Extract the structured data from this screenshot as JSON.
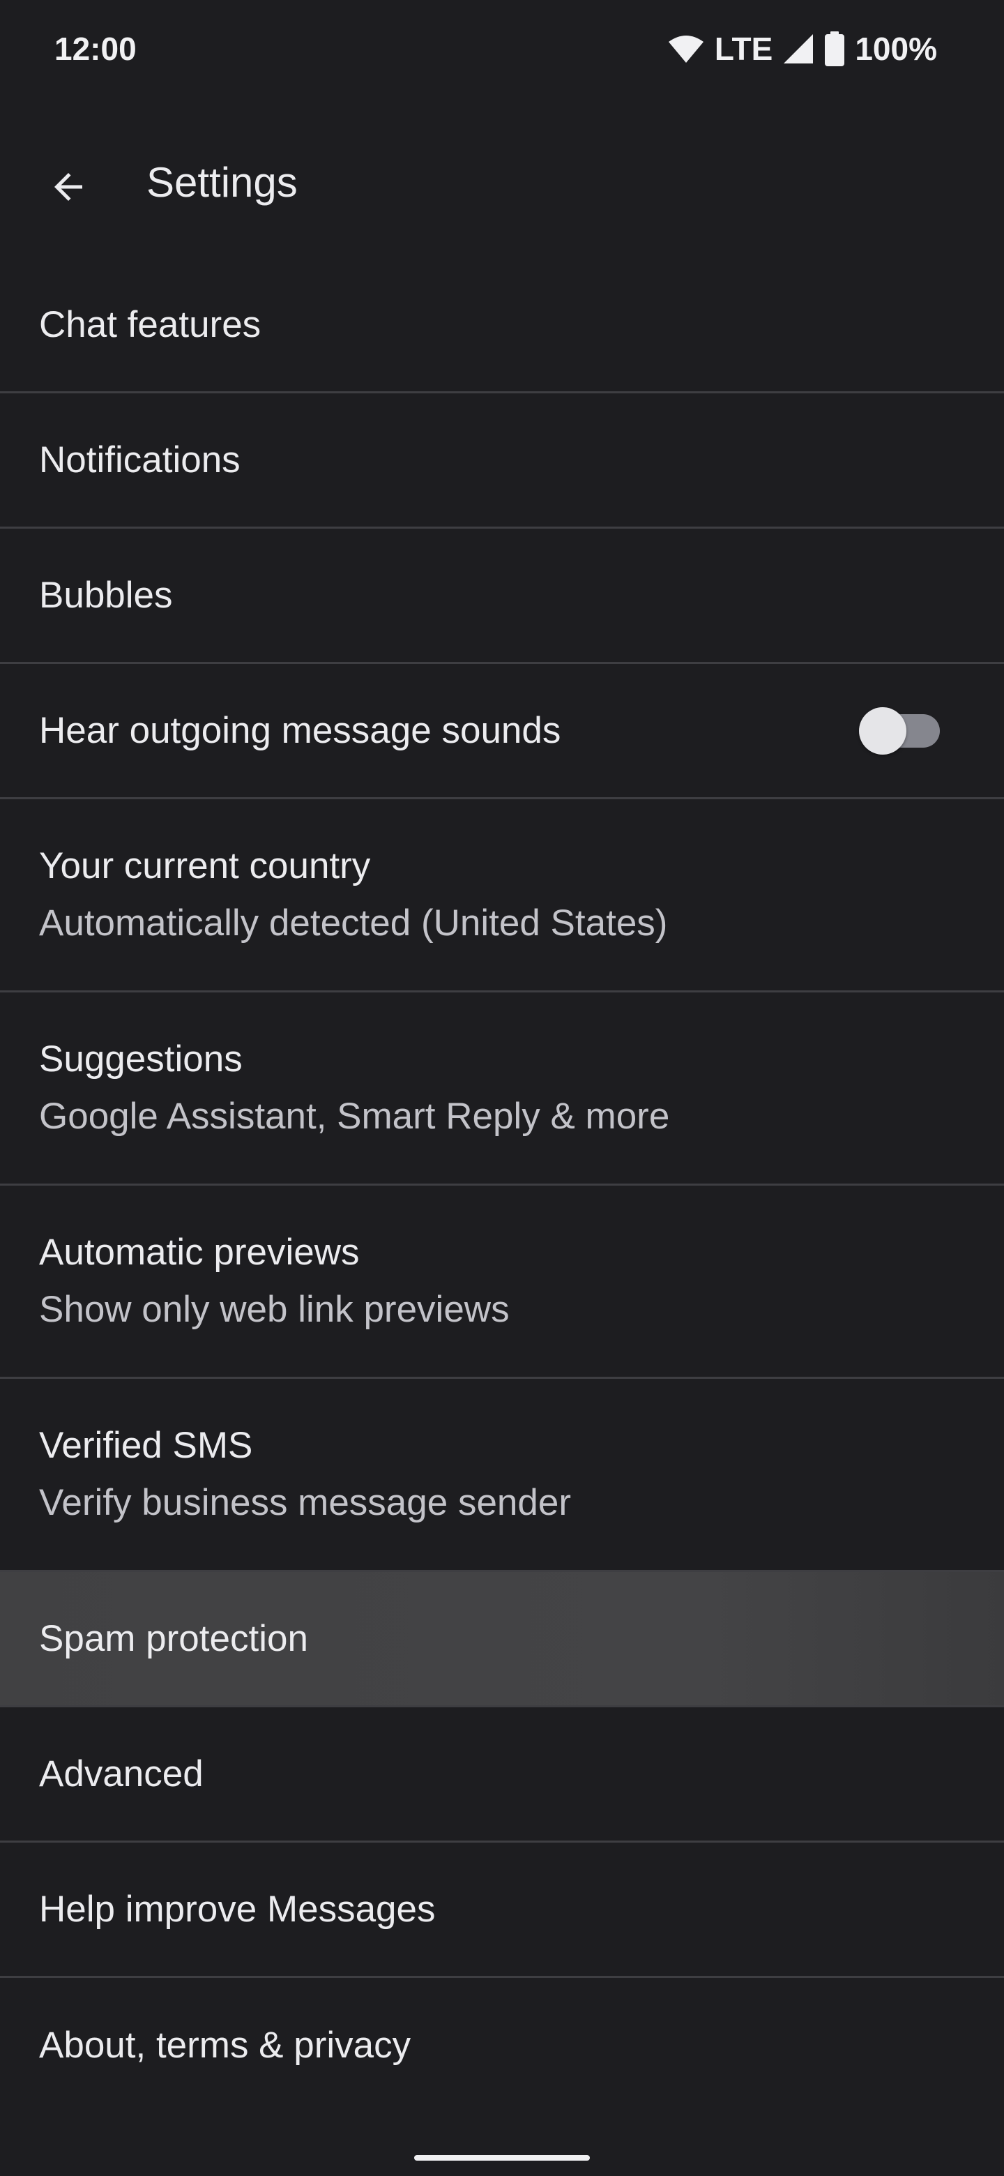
{
  "status_bar": {
    "time": "12:00",
    "network": "LTE",
    "battery": "100%",
    "icons": [
      "wifi-icon",
      "signal-icon",
      "battery-icon"
    ]
  },
  "header": {
    "back_icon": "arrow-back-icon",
    "title": "Settings"
  },
  "settings": {
    "chat_features": {
      "title": "Chat features"
    },
    "notifications": {
      "title": "Notifications"
    },
    "bubbles": {
      "title": "Bubbles"
    },
    "outgoing_sounds": {
      "title": "Hear outgoing message sounds",
      "enabled": false
    },
    "current_country": {
      "title": "Your current country",
      "subtitle": "Automatically detected (United States)"
    },
    "suggestions": {
      "title": "Suggestions",
      "subtitle": "Google Assistant, Smart Reply & more"
    },
    "automatic_previews": {
      "title": "Automatic previews",
      "subtitle": "Show only web link previews"
    },
    "verified_sms": {
      "title": "Verified SMS",
      "subtitle": "Verify business message sender"
    },
    "spam_protection": {
      "title": "Spam protection",
      "pressed": true
    },
    "advanced": {
      "title": "Advanced"
    },
    "help_improve": {
      "title": "Help improve Messages"
    },
    "about": {
      "title": "About, terms & privacy"
    }
  },
  "colors": {
    "background": "#1d1d20",
    "divider": "#3e3e42",
    "text_primary": "#ececef",
    "text_secondary": "#c3c3c9",
    "highlight": "#434345",
    "toggle_track_off": "#85868e",
    "toggle_thumb_off": "#e5e5e8"
  }
}
